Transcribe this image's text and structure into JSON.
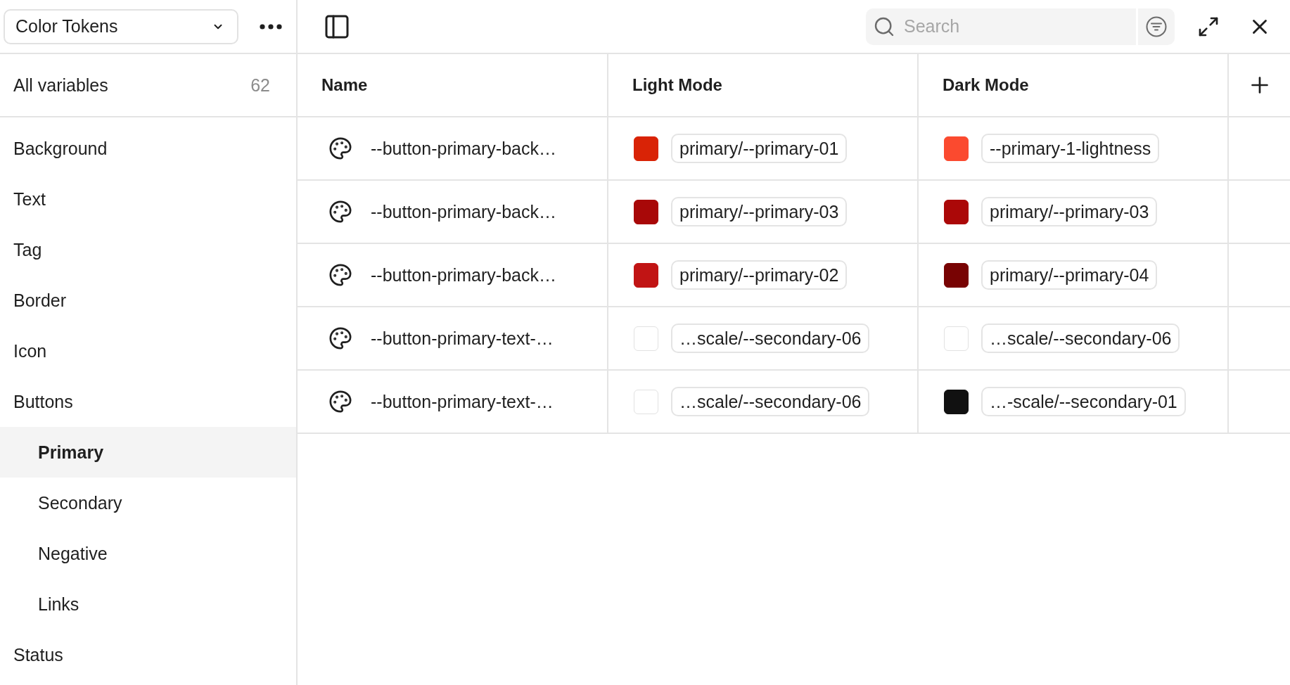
{
  "toolbar": {
    "collection_selector": {
      "value": "Color Tokens"
    },
    "search": {
      "placeholder": "Search"
    }
  },
  "sidebar": {
    "all_variables": {
      "label": "All variables",
      "count": "62",
      "selected": false
    },
    "groups": [
      {
        "label": "Background",
        "selected": false
      },
      {
        "label": "Text",
        "selected": false
      },
      {
        "label": "Tag",
        "selected": false
      },
      {
        "label": "Border",
        "selected": false
      },
      {
        "label": "Icon",
        "selected": false
      },
      {
        "label": "Buttons",
        "selected": false,
        "children": [
          {
            "label": "Primary",
            "selected": true
          },
          {
            "label": "Secondary",
            "selected": false
          },
          {
            "label": "Negative",
            "selected": false
          },
          {
            "label": "Links",
            "selected": false
          }
        ]
      },
      {
        "label": "Status",
        "selected": false
      }
    ]
  },
  "table": {
    "columns": [
      {
        "label": "Name"
      },
      {
        "label": "Light Mode"
      },
      {
        "label": "Dark Mode"
      }
    ],
    "rows": [
      {
        "name": "--button-primary-back…",
        "light": {
          "color": "#d92306",
          "value": "primary/--primary-01"
        },
        "dark": {
          "color": "#fb4a2f",
          "value": "--primary-1-lightness"
        }
      },
      {
        "name": "--button-primary-back…",
        "light": {
          "color": "#a80808",
          "value": "primary/--primary-03"
        },
        "dark": {
          "color": "#ab0808",
          "value": "primary/--primary-03"
        }
      },
      {
        "name": "--button-primary-back…",
        "light": {
          "color": "#c11414",
          "value": "primary/--primary-02"
        },
        "dark": {
          "color": "#780303",
          "value": "primary/--primary-04"
        }
      },
      {
        "name": "--button-primary-text-…",
        "light": {
          "color": "#ffffff",
          "value": "…scale/--secondary-06"
        },
        "dark": {
          "color": "#ffffff",
          "value": "…scale/--secondary-06"
        }
      },
      {
        "name": "--button-primary-text-…",
        "light": {
          "color": "#ffffff",
          "value": "…scale/--secondary-06"
        },
        "dark": {
          "color": "#111111",
          "value": "…-scale/--secondary-01"
        }
      }
    ]
  }
}
